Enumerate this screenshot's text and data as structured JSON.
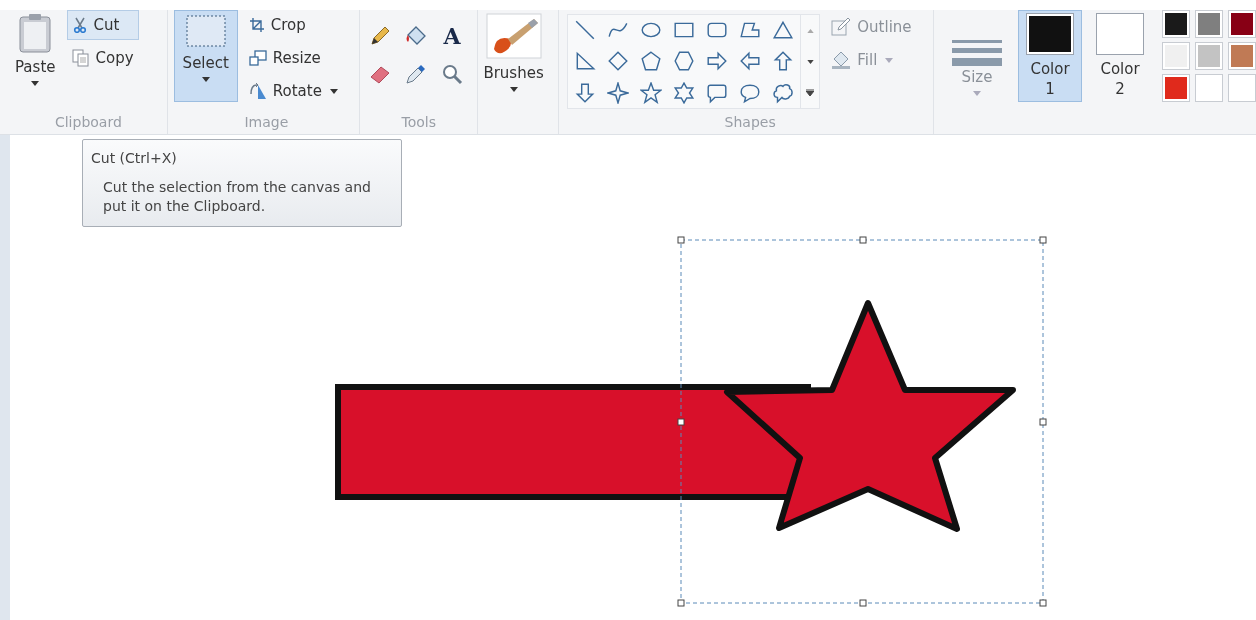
{
  "clipboard": {
    "label": "Clipboard",
    "paste": "Paste",
    "items": [
      {
        "kind": "cut",
        "label": "Cut",
        "hovered": true
      },
      {
        "kind": "copy",
        "label": "Copy",
        "hovered": false
      }
    ]
  },
  "image": {
    "label": "Image",
    "select": {
      "label": "Select",
      "selected": true
    },
    "items": [
      {
        "kind": "crop",
        "label": "Crop",
        "dropdown": false
      },
      {
        "kind": "resize",
        "label": "Resize",
        "dropdown": false
      },
      {
        "kind": "rotate",
        "label": "Rotate",
        "dropdown": true
      }
    ]
  },
  "tools": {
    "label": "Tools",
    "items": [
      {
        "kind": "pencil"
      },
      {
        "kind": "bucket"
      },
      {
        "kind": "text",
        "glyph": "A"
      },
      {
        "kind": "eraser"
      },
      {
        "kind": "picker"
      },
      {
        "kind": "magnifier"
      }
    ]
  },
  "brushes": {
    "label": "Brushes"
  },
  "shapes": {
    "label": "Shapes",
    "outline": "Outline",
    "fill": "Fill",
    "items": [
      {
        "kind": "line"
      },
      {
        "kind": "curve"
      },
      {
        "kind": "oval"
      },
      {
        "kind": "rectangle"
      },
      {
        "kind": "rounded-rectangle"
      },
      {
        "kind": "polygon"
      },
      {
        "kind": "triangle"
      },
      {
        "kind": "right-triangle"
      },
      {
        "kind": "diamond"
      },
      {
        "kind": "pentagon"
      },
      {
        "kind": "hexagon"
      },
      {
        "kind": "right-arrow"
      },
      {
        "kind": "left-arrow"
      },
      {
        "kind": "up-arrow"
      },
      {
        "kind": "down-arrow"
      },
      {
        "kind": "four-point-star"
      },
      {
        "kind": "five-point-star"
      },
      {
        "kind": "six-point-star"
      },
      {
        "kind": "rounded-callout"
      },
      {
        "kind": "oval-callout"
      },
      {
        "kind": "cloud-callout"
      }
    ]
  },
  "size": {
    "label": "Size"
  },
  "colors": [
    {
      "label": "Color 1",
      "selected": true,
      "color": "#111111"
    },
    {
      "label": "Color 2",
      "selected": false,
      "color": "#ffffff"
    }
  ],
  "palette": [
    {
      "color": "#1a1a1a"
    },
    {
      "color": "#7f7f7f"
    },
    {
      "color": "#880015"
    },
    {
      "color": "#f0f0f0"
    },
    {
      "color": "#c3c3c3"
    },
    {
      "color": "#c07a55"
    },
    {
      "color": "#e02a1c"
    },
    {
      "color": "#ffffff"
    },
    {
      "color": "#ffffff"
    }
  ],
  "tooltip": {
    "title": "Cut (Ctrl+X)",
    "text": "Cut the selection from the canvas and put it on the Clipboard."
  }
}
